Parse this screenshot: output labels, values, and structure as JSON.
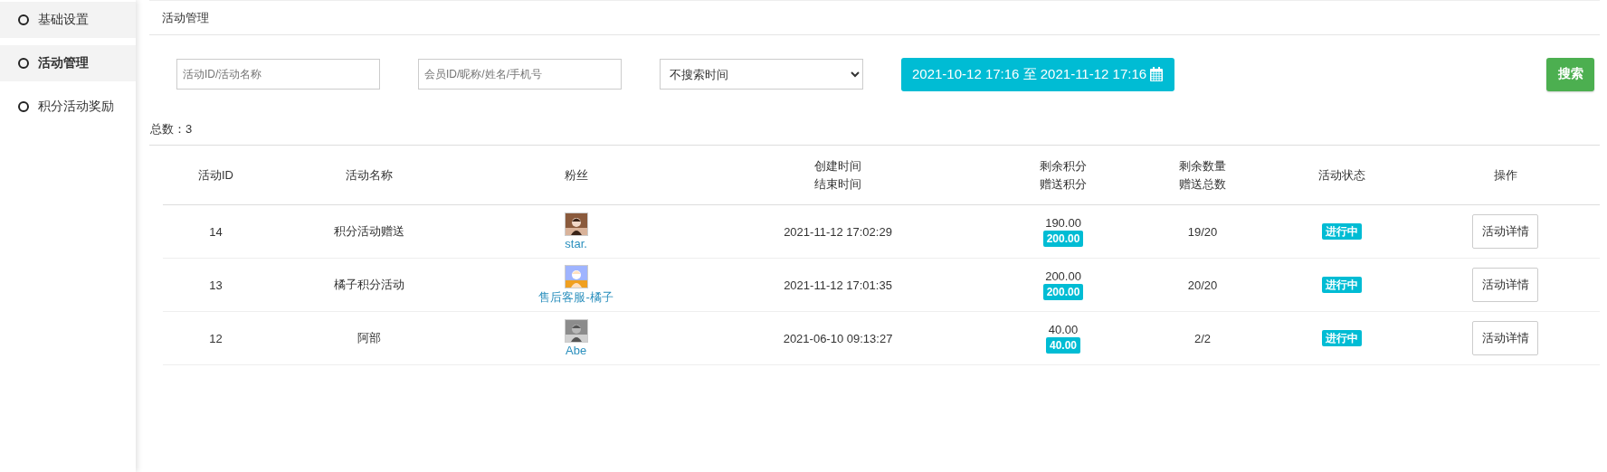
{
  "sidebar": {
    "items": [
      {
        "label": "基础设置",
        "selected": false
      },
      {
        "label": "活动管理",
        "selected": true
      },
      {
        "label": "积分活动奖励",
        "selected": false
      }
    ]
  },
  "header": {
    "title": "活动管理"
  },
  "filters": {
    "activity_search": {
      "placeholder": "活动ID/活动名称"
    },
    "member_search": {
      "placeholder": "会员ID/昵称/姓名/手机号"
    },
    "time_select": {
      "value": "不搜索时间"
    },
    "date_range": "2021-10-12 17:16 至 2021-11-12 17:16",
    "search_button": "搜索"
  },
  "total": "总数：3",
  "table": {
    "columns": [
      [
        "活动ID"
      ],
      [
        "活动名称"
      ],
      [
        "粉丝"
      ],
      [
        "创建时间",
        "结束时间"
      ],
      [
        "剩余积分",
        "赠送积分"
      ],
      [
        "剩余数量",
        "赠送总数"
      ],
      [
        "活动状态"
      ],
      [
        "操作"
      ]
    ],
    "rows": [
      {
        "id": "14",
        "name": "积分活动赠送",
        "fan": "star.",
        "time": "2021-11-12 17:02:29",
        "remaining_points": "190.00",
        "given_points": "200.00",
        "quantity": "19/20",
        "status": "进行中",
        "action": "活动详情"
      },
      {
        "id": "13",
        "name": "橘子积分活动",
        "fan": "售后客服-橘子",
        "time": "2021-11-12 17:01:35",
        "remaining_points": "200.00",
        "given_points": "200.00",
        "quantity": "20/20",
        "status": "进行中",
        "action": "活动详情"
      },
      {
        "id": "12",
        "name": "阿部",
        "fan": "Abe",
        "time": "2021-06-10 09:13:27",
        "remaining_points": "40.00",
        "given_points": "40.00",
        "quantity": "2/2",
        "status": "进行中",
        "action": "活动详情"
      }
    ]
  }
}
